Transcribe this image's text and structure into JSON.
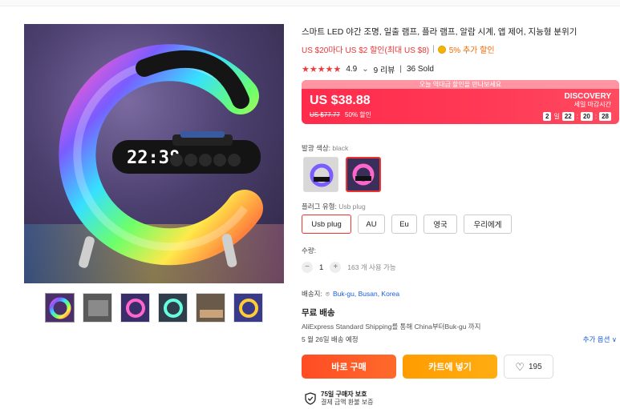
{
  "product": {
    "title": "스마트 LED 야간 조명, 일출 램프, 플라 램프, 알람 시계, 앱 제어, 지능형 분위기",
    "promo": "US $20마다 US $2 할인(최대 US $8)",
    "extra_discount": "5% 추가 할인",
    "rating": "4.9",
    "reviews": "9 리뷰",
    "sold": "36 Sold",
    "clock_display": "22:38"
  },
  "deal": {
    "banner": "오늘 역대급 할인을 만나보세요",
    "price": "US $38.88",
    "original_price": "US $77.77",
    "discount": "50% 할인",
    "event_name": "DISCOVERY",
    "ends_label": "세일 마감시간",
    "timer": {
      "days": "2",
      "day_label": "일",
      "hours": "22",
      "minutes": "20",
      "seconds": "28"
    }
  },
  "options": {
    "color_label": "발광 색상: ",
    "color_value": "black",
    "plug_label": "플러그 유형: ",
    "plug_value": "Usb plug",
    "plugs": [
      "Usb plug",
      "AU",
      "Eu",
      "영국",
      "우리에게"
    ]
  },
  "quantity": {
    "label": "수량:",
    "value": "1",
    "available": "163 개 사용 가능",
    "minus": "−",
    "plus": "+"
  },
  "shipping": {
    "ship_to_label": "배송지:",
    "location": "Buk-gu, Busan, Korea",
    "free": "무료 배송",
    "method": "AliExpress Standard Shipping를 통해 China부터Buk-gu 까지",
    "eta": "5 월 26일 배송 예정",
    "more_options": "추가 옵션 ∨"
  },
  "actions": {
    "buy_now": "바로 구매",
    "add_to_cart": "카트에 넣기",
    "wishlist_count": "195"
  },
  "protection": {
    "title": "75일 구매자 보호",
    "subtitle": "결제 금액 환불 보증"
  },
  "colors": {
    "accent": "#ef3a3a",
    "buy": "#ff5226",
    "cart": "#ffa20a",
    "link": "#1a5fd6"
  }
}
